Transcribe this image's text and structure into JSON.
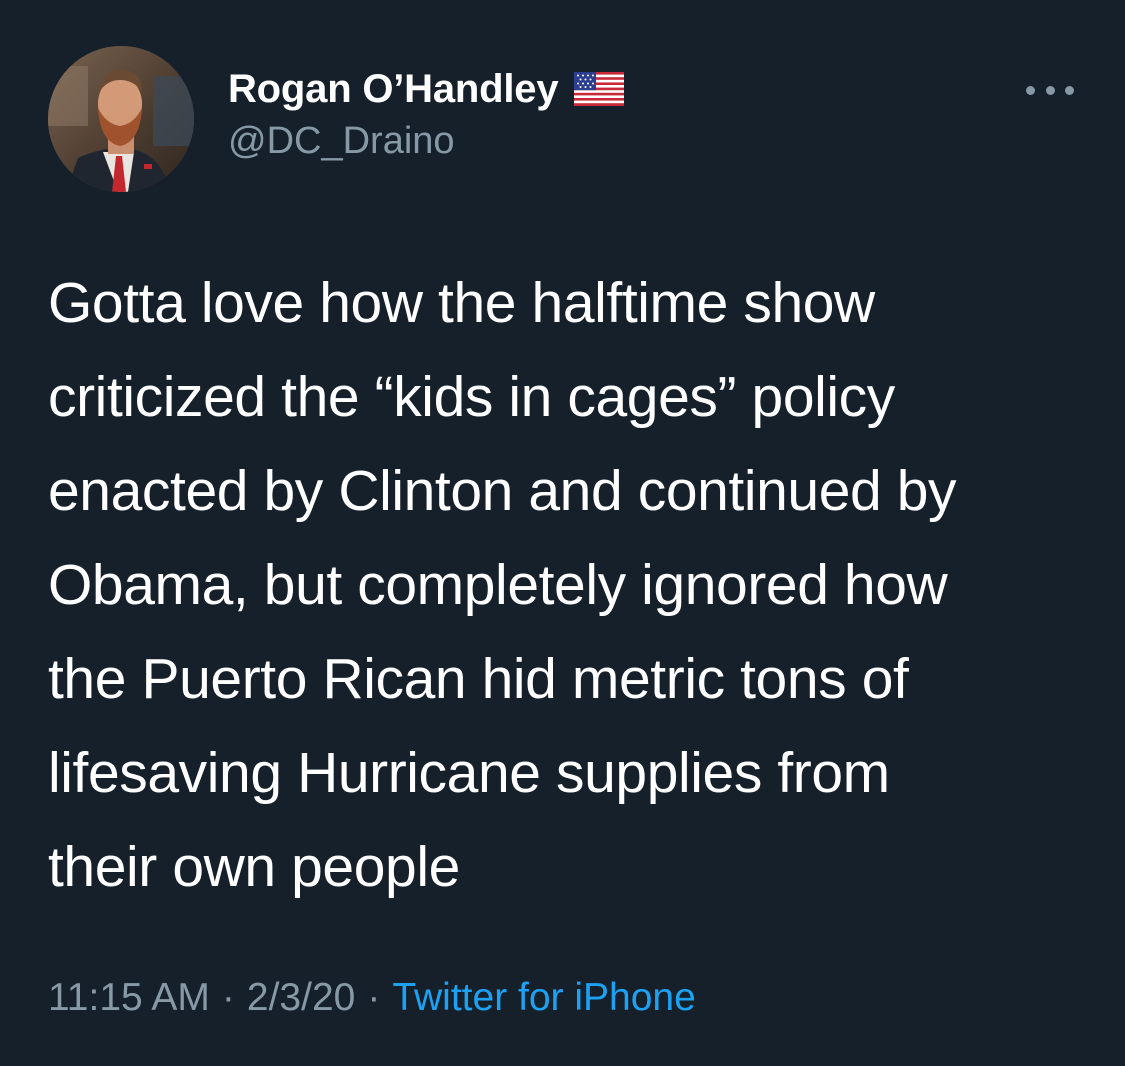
{
  "author": {
    "display_name": "Rogan O’Handley",
    "badge_icon": "us-flag-icon",
    "handle": "@DC_Draino"
  },
  "menu": {
    "icon": "more-options-icon"
  },
  "tweet": {
    "lines": [
      "Gotta love how the halftime show",
      "criticized the “kids in cages” policy",
      "enacted by Clinton and continued by",
      "Obama, but completely ignored how",
      "the Puerto Rican hid metric tons of",
      "lifesaving Hurricane supplies from",
      "their own people"
    ]
  },
  "meta": {
    "time": "11:15 AM",
    "separator": "·",
    "date": "2/3/20",
    "source": "Twitter for iPhone"
  },
  "colors": {
    "background": "#15202b",
    "primary_text": "#ffffff",
    "secondary_text": "#8899a6",
    "link": "#1da1f2"
  }
}
